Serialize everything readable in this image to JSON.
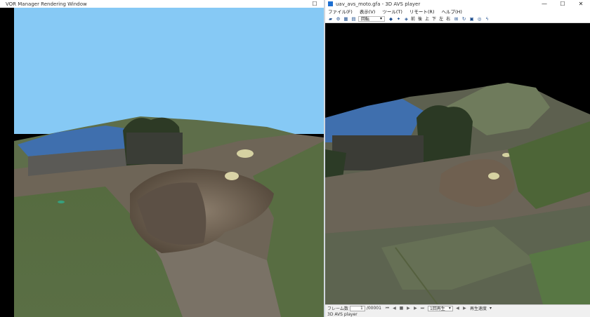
{
  "left_window": {
    "title": "VOR Manager Rendering Window",
    "maximize_glyph": "☐"
  },
  "right_window": {
    "title": "uav_avs_moto.gfa - 3D AVS player",
    "minimize_glyph": "—",
    "maximize_glyph": "☐",
    "close_glyph": "✕",
    "menu": [
      "ファイル(F)",
      "表示(V)",
      "ツール(T)",
      "リモート(R)",
      "ヘルプ(H)"
    ],
    "toolbar": {
      "view_select": "回転",
      "view_labels": [
        "前",
        "後",
        "上",
        "下",
        "左",
        "右"
      ]
    },
    "playbar": {
      "frame_label": "フレーム数",
      "frame_current": "1",
      "frame_total": "/00001",
      "mode_select": "1回再生",
      "speed_label": "再生速度"
    },
    "status": "3D AVS player"
  },
  "colors": {
    "sky": "#86c9f5",
    "roof": "#3f6fae",
    "grass": "#55703a",
    "soil": "#6e6153",
    "accent_blue": "#1d4e8f"
  }
}
